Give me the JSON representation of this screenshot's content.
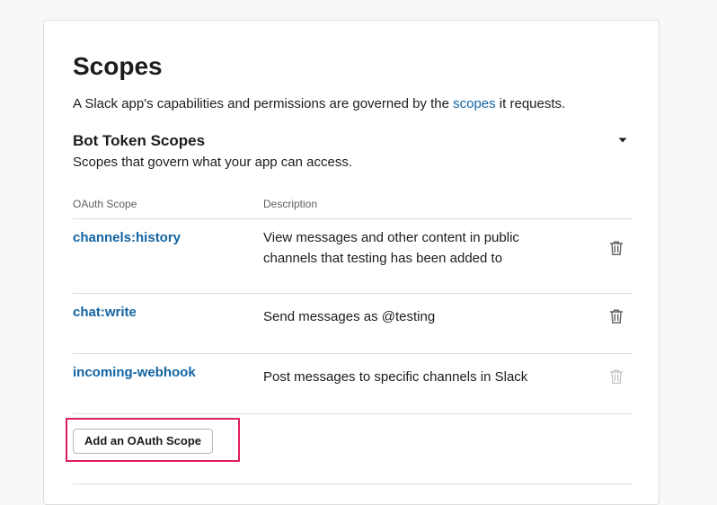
{
  "page": {
    "title": "Scopes",
    "intro_before": "A Slack app's capabilities and permissions are governed by the ",
    "intro_link": "scopes",
    "intro_after": " it requests."
  },
  "bot_scopes": {
    "title": "Bot Token Scopes",
    "subtitle": "Scopes that govern what your app can access.",
    "toggle_icon": "caret-down-icon",
    "columns": {
      "scope": "OAuth Scope",
      "description": "Description"
    },
    "rows": [
      {
        "scope": "channels:history",
        "description": "View messages and other content in public channels that testing has been added to",
        "remove_icon": "trash-icon",
        "remove_enabled": true
      },
      {
        "scope": "chat:write",
        "description": "Send messages as @testing",
        "remove_icon": "trash-icon",
        "remove_enabled": true
      },
      {
        "scope": "incoming-webhook",
        "description": "Post messages to specific channels in Slack",
        "remove_icon": "trash-icon",
        "remove_enabled": false
      }
    ],
    "add_button_label": "Add an OAuth Scope"
  },
  "colors": {
    "link": "#1264a3",
    "text": "#1d1c1d",
    "muted_text": "#616061",
    "divider": "#dddddd",
    "icon_active": "#616061",
    "icon_disabled": "#c6c6c6",
    "highlight_box": "#e01e5a"
  }
}
